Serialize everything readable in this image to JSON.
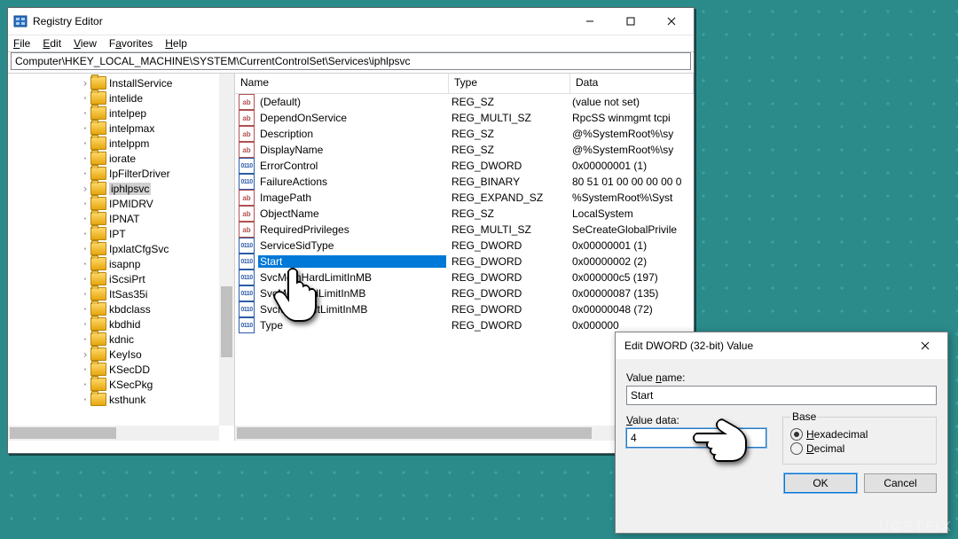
{
  "regedit": {
    "title": "Registry Editor",
    "menu": {
      "file": "File",
      "edit": "Edit",
      "view": "View",
      "favorites": "Favorites",
      "help": "Help"
    },
    "path": "Computer\\HKEY_LOCAL_MACHINE\\SYSTEM\\CurrentControlSet\\Services\\iphlpsvc",
    "tree": [
      {
        "label": "InstallService",
        "indent": 80,
        "exp": ">"
      },
      {
        "label": "intelide",
        "indent": 80
      },
      {
        "label": "intelpep",
        "indent": 80
      },
      {
        "label": "intelpmax",
        "indent": 80
      },
      {
        "label": "intelppm",
        "indent": 80
      },
      {
        "label": "iorate",
        "indent": 80
      },
      {
        "label": "IpFilterDriver",
        "indent": 80
      },
      {
        "label": "iphlpsvc",
        "indent": 80,
        "sel": true,
        "exp": ">"
      },
      {
        "label": "IPMIDRV",
        "indent": 80
      },
      {
        "label": "IPNAT",
        "indent": 80
      },
      {
        "label": "IPT",
        "indent": 80
      },
      {
        "label": "IpxlatCfgSvc",
        "indent": 80
      },
      {
        "label": "isapnp",
        "indent": 80
      },
      {
        "label": "iScsiPrt",
        "indent": 80
      },
      {
        "label": "ItSas35i",
        "indent": 80
      },
      {
        "label": "kbdclass",
        "indent": 80
      },
      {
        "label": "kbdhid",
        "indent": 80
      },
      {
        "label": "kdnic",
        "indent": 80
      },
      {
        "label": "KeyIso",
        "indent": 80,
        "exp": ">"
      },
      {
        "label": "KSecDD",
        "indent": 80
      },
      {
        "label": "KSecPkg",
        "indent": 80
      },
      {
        "label": "ksthunk",
        "indent": 80
      }
    ],
    "columns": {
      "name": "Name",
      "type": "Type",
      "data": "Data"
    },
    "values": [
      {
        "ico": "ab",
        "name": "(Default)",
        "type": "REG_SZ",
        "data": "(value not set)"
      },
      {
        "ico": "ab",
        "name": "DependOnService",
        "type": "REG_MULTI_SZ",
        "data": "RpcSS winmgmt tcpi"
      },
      {
        "ico": "ab",
        "name": "Description",
        "type": "REG_SZ",
        "data": "@%SystemRoot%\\sy"
      },
      {
        "ico": "ab",
        "name": "DisplayName",
        "type": "REG_SZ",
        "data": "@%SystemRoot%\\sy"
      },
      {
        "ico": "bin",
        "name": "ErrorControl",
        "type": "REG_DWORD",
        "data": "0x00000001 (1)"
      },
      {
        "ico": "bin",
        "name": "FailureActions",
        "type": "REG_BINARY",
        "data": "80 51 01 00 00 00 00 0"
      },
      {
        "ico": "ab",
        "name": "ImagePath",
        "type": "REG_EXPAND_SZ",
        "data": "%SystemRoot%\\Syst"
      },
      {
        "ico": "ab",
        "name": "ObjectName",
        "type": "REG_SZ",
        "data": "LocalSystem"
      },
      {
        "ico": "ab",
        "name": "RequiredPrivileges",
        "type": "REG_MULTI_SZ",
        "data": "SeCreateGlobalPrivile"
      },
      {
        "ico": "bin",
        "name": "ServiceSidType",
        "type": "REG_DWORD",
        "data": "0x00000001 (1)"
      },
      {
        "ico": "bin",
        "name": "Start",
        "type": "REG_DWORD",
        "data": "0x00000002 (2)",
        "sel": true
      },
      {
        "ico": "bin",
        "name": "SvcMemHardLimitInMB",
        "type": "REG_DWORD",
        "data": "0x000000c5 (197)"
      },
      {
        "ico": "bin",
        "name": "SvcMemMidLimitInMB",
        "type": "REG_DWORD",
        "data": "0x00000087 (135)"
      },
      {
        "ico": "bin",
        "name": "SvcMemSoftLimitInMB",
        "type": "REG_DWORD",
        "data": "0x00000048 (72)"
      },
      {
        "ico": "bin",
        "name": "Type",
        "type": "REG_DWORD",
        "data": "0x000000"
      }
    ]
  },
  "dialog": {
    "title": "Edit DWORD (32-bit) Value",
    "value_name_label": "Value name:",
    "value_name": "Start",
    "value_data_label": "Value data:",
    "value_data": "4",
    "base_label": "Base",
    "hex_label": "Hexadecimal",
    "dec_label": "Decimal",
    "ok": "OK",
    "cancel": "Cancel"
  },
  "watermark": "UGETFIX"
}
